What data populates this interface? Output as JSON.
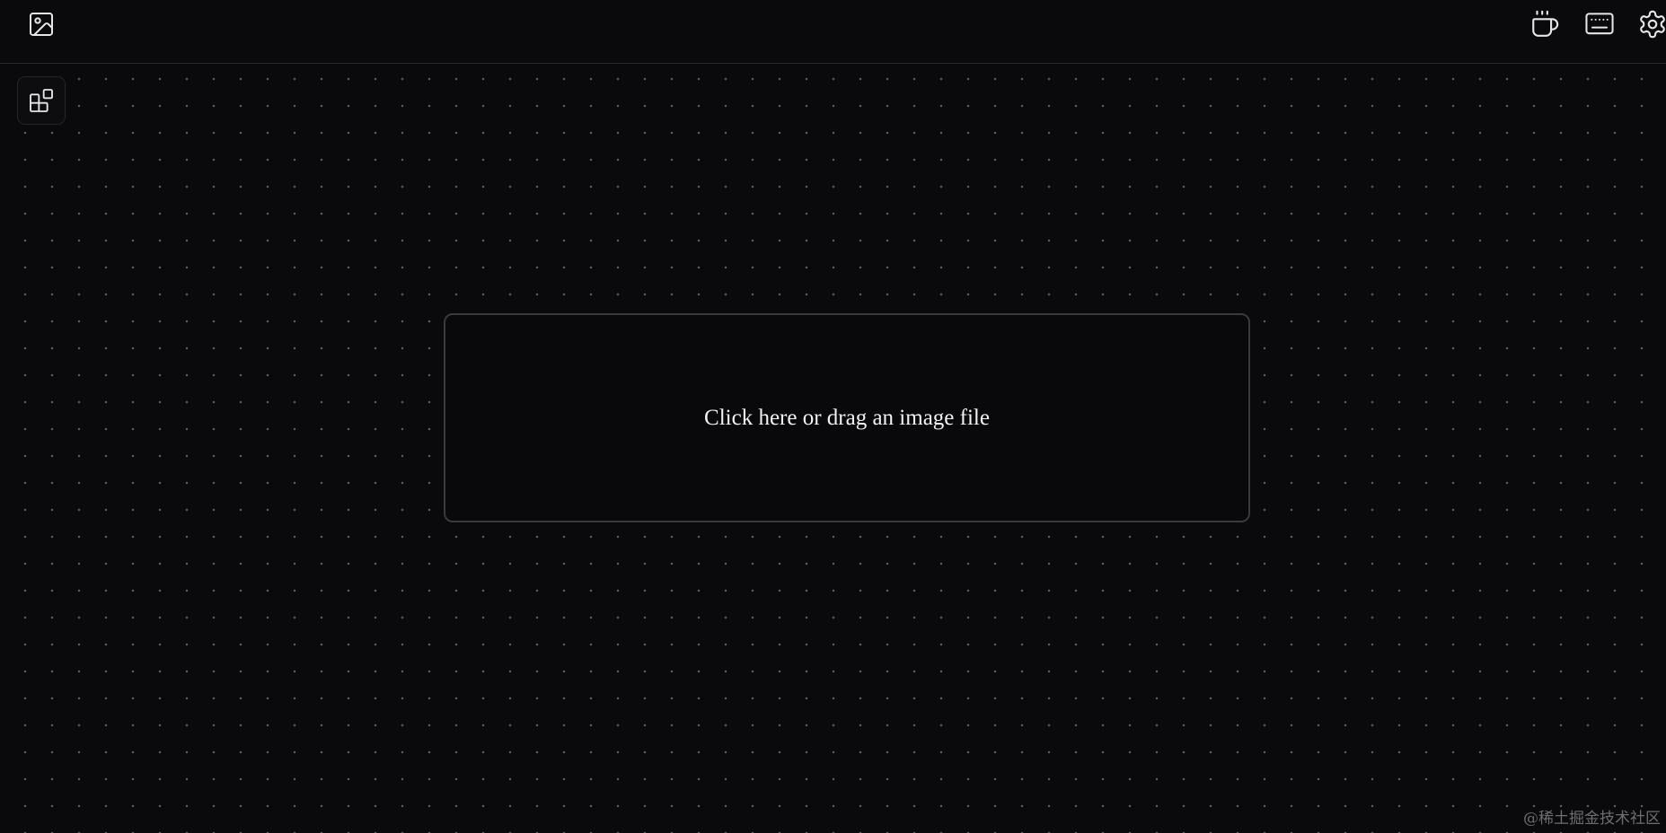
{
  "toolbar": {
    "left_icons": [
      {
        "icon": "image-icon"
      }
    ],
    "right_icons": [
      {
        "icon": "coffee-cup-icon"
      },
      {
        "icon": "keyboard-icon"
      },
      {
        "icon": "gear-icon"
      }
    ]
  },
  "sidebar": {
    "layout_toggle_icon": "grid-layout-icon"
  },
  "dropzone": {
    "label": "Click here or drag an image file"
  },
  "watermark": {
    "text": "@稀土掘金技术社区"
  },
  "colors": {
    "background": "#0a0a0c",
    "dot": "#5c5c62",
    "border": "#3a3a3e",
    "text": "#f2f2f2",
    "icon": "#e6e6e6"
  }
}
